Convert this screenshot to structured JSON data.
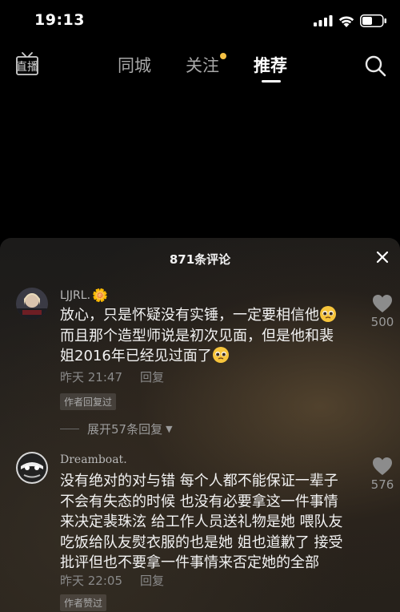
{
  "status_bar": {
    "time": "19:13"
  },
  "top_nav": {
    "live_label": "直播",
    "tabs": [
      {
        "label": "同城"
      },
      {
        "label": "关注"
      },
      {
        "label": "推荐"
      }
    ],
    "active_tab": "推荐"
  },
  "comments_sheet": {
    "title": "871条评论",
    "comments": [
      {
        "username": "LJJRL.",
        "text_lines": [
          "放心，只是怀疑没有实锤，一定要相信他",
          "而且那个造型师说是初次见面，但是他和裴",
          "姐2016年已经见过面了"
        ],
        "time": "昨天 21:47",
        "reply_label": "回复",
        "badge": "作者回复过",
        "likes": "500"
      },
      {
        "username": "Dreamboat.",
        "text_lines": [
          "没有绝对的对与错 每个人都不能保证一辈子",
          "不会有失态的时候 也没有必要拿这一件事情",
          "来决定裴珠泫 给工作人员送礼物是她 喂队友",
          "吃饭给队友熨衣服的也是她 姐也道歉了 接受",
          "批评但也不要拿一件事情来否定她的全部"
        ],
        "time": "昨天 22:05",
        "reply_label": "回复",
        "badge": "作者赞过",
        "likes": "576"
      }
    ],
    "expand_label": "展开57条回复"
  },
  "colors": {
    "follow_dot": "#f5c144",
    "background": "#000000"
  }
}
